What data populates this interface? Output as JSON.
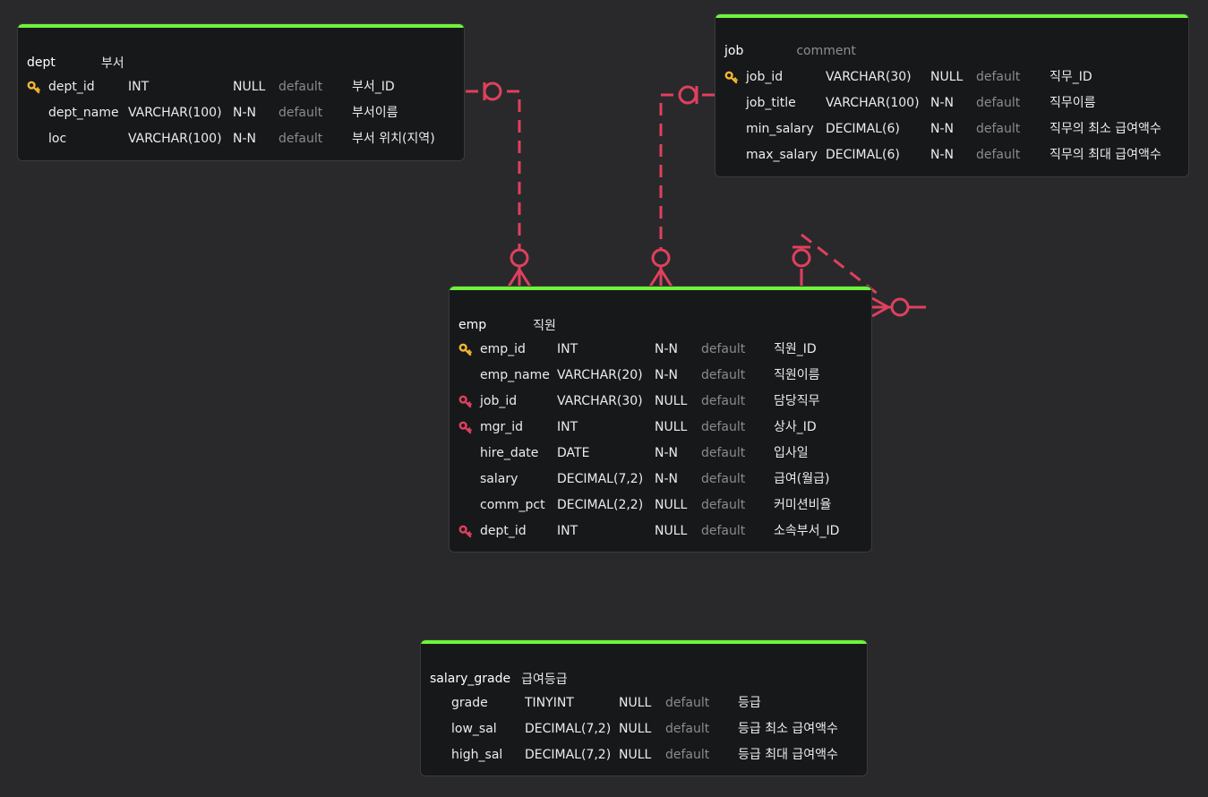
{
  "colors": {
    "background": "#29292b",
    "table_bg": "#17181a",
    "table_accent": "#6ef43a",
    "relation_line": "#e0405e",
    "primary_key": "#f2b630",
    "foreign_key": "#e0405e",
    "muted_text": "#8b8b8b"
  },
  "tables": {
    "dept": {
      "name": "dept",
      "comment": "부서",
      "columns": [
        {
          "key": "primary-key-icon",
          "name": "dept_id",
          "type": "INT",
          "null": "NULL",
          "default": "default",
          "comment": "부서_ID"
        },
        {
          "key": "",
          "name": "dept_name",
          "type": "VARCHAR(100)",
          "null": "N-N",
          "default": "default",
          "comment": "부서이름"
        },
        {
          "key": "",
          "name": "loc",
          "type": "VARCHAR(100)",
          "null": "N-N",
          "default": "default",
          "comment": "부서 위치(지역)"
        }
      ]
    },
    "job": {
      "name": "job",
      "comment": "comment",
      "columns": [
        {
          "key": "primary-key-icon",
          "name": "job_id",
          "type": "VARCHAR(30)",
          "null": "NULL",
          "default": "default",
          "comment": "직무_ID"
        },
        {
          "key": "",
          "name": "job_title",
          "type": "VARCHAR(100)",
          "null": "N-N",
          "default": "default",
          "comment": "직무이름"
        },
        {
          "key": "",
          "name": "min_salary",
          "type": "DECIMAL(6)",
          "null": "N-N",
          "default": "default",
          "comment": "직무의 최소 급여액수"
        },
        {
          "key": "",
          "name": "max_salary",
          "type": "DECIMAL(6)",
          "null": "N-N",
          "default": "default",
          "comment": "직무의 최대 급여액수"
        }
      ]
    },
    "emp": {
      "name": "emp",
      "comment": "직원",
      "columns": [
        {
          "key": "primary-key-icon",
          "name": "emp_id",
          "type": "INT",
          "null": "N-N",
          "default": "default",
          "comment": "직원_ID"
        },
        {
          "key": "",
          "name": "emp_name",
          "type": "VARCHAR(20)",
          "null": "N-N",
          "default": "default",
          "comment": "직원이름"
        },
        {
          "key": "foreign-key-icon",
          "name": "job_id",
          "type": "VARCHAR(30)",
          "null": "NULL",
          "default": "default",
          "comment": "담당직무"
        },
        {
          "key": "foreign-key-icon",
          "name": "mgr_id",
          "type": "INT",
          "null": "NULL",
          "default": "default",
          "comment": "상사_ID"
        },
        {
          "key": "",
          "name": "hire_date",
          "type": "DATE",
          "null": "N-N",
          "default": "default",
          "comment": "입사일"
        },
        {
          "key": "",
          "name": "salary",
          "type": "DECIMAL(7,2)",
          "null": "N-N",
          "default": "default",
          "comment": "급여(월급)"
        },
        {
          "key": "",
          "name": "comm_pct",
          "type": "DECIMAL(2,2)",
          "null": "NULL",
          "default": "default",
          "comment": "커미션비율"
        },
        {
          "key": "foreign-key-icon",
          "name": "dept_id",
          "type": "INT",
          "null": "NULL",
          "default": "default",
          "comment": "소속부서_ID"
        }
      ]
    },
    "salary_grade": {
      "name": "salary_grade",
      "comment": "급여등급",
      "columns": [
        {
          "key": "",
          "name": "grade",
          "type": "TINYINT",
          "null": "NULL",
          "default": "default",
          "comment": "등급"
        },
        {
          "key": "",
          "name": "low_sal",
          "type": "DECIMAL(7,2)",
          "null": "NULL",
          "default": "default",
          "comment": "등급 최소 급여액수"
        },
        {
          "key": "",
          "name": "high_sal",
          "type": "DECIMAL(7,2)",
          "null": "NULL",
          "default": "default",
          "comment": "등급 최대 급여액수"
        }
      ]
    }
  },
  "relations": [
    {
      "from": "dept.dept_id",
      "to": "emp.dept_id",
      "cardinality": "zero-or-one to zero-or-many"
    },
    {
      "from": "job.job_id",
      "to": "emp.job_id",
      "cardinality": "zero-or-one to zero-or-many"
    },
    {
      "from": "emp.emp_id",
      "to": "emp.mgr_id",
      "cardinality": "zero-or-one to zero-or-many"
    }
  ]
}
